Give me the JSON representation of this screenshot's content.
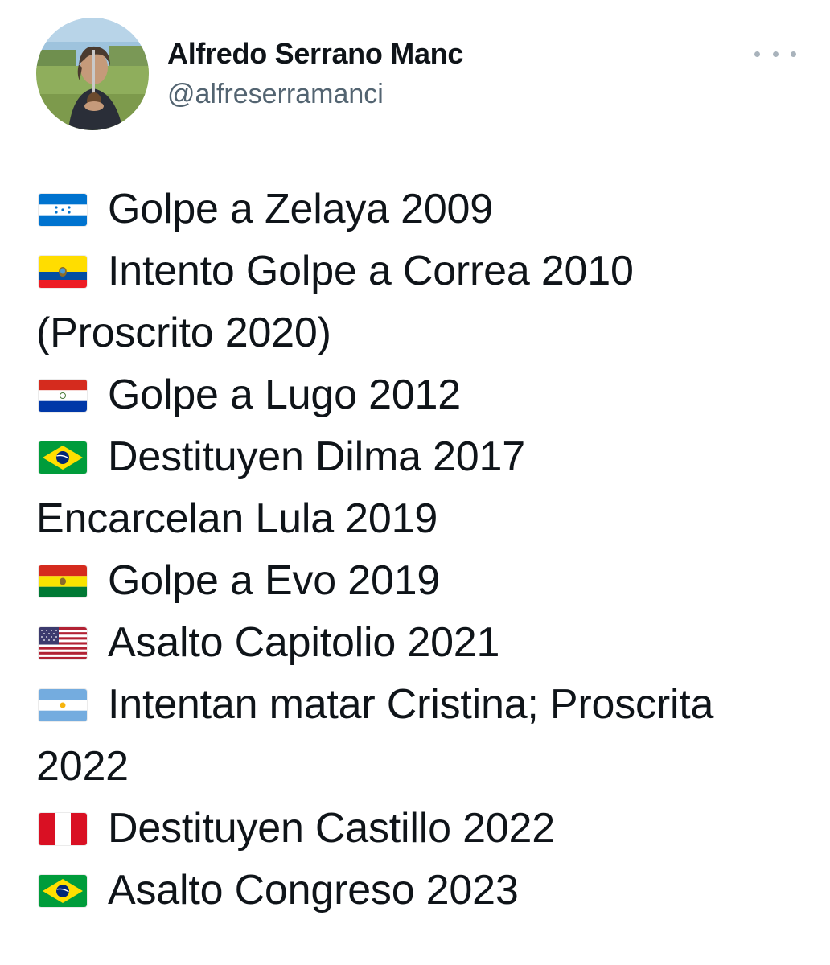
{
  "tweet": {
    "display_name": "Alfredo Serrano Manc",
    "handle": "@alfreserramanci",
    "avatar_icon": "profile-photo",
    "more_icon": "more-options-icon",
    "lines": [
      {
        "flag": "honduras-flag-icon",
        "text": "Golpe a Zelaya 2009"
      },
      {
        "flag": "ecuador-flag-icon",
        "text": "Intento Golpe a Correa 2010"
      },
      {
        "flag": "",
        "text": "(Proscrito 2020)"
      },
      {
        "flag": "paraguay-flag-icon",
        "text": "Golpe a Lugo 2012"
      },
      {
        "flag": "brazil-flag-icon",
        "text": "Destituyen Dilma 2017"
      },
      {
        "flag": "",
        "text": "Encarcelan Lula 2019"
      },
      {
        "flag": "bolivia-flag-icon",
        "text": "Golpe a Evo 2019"
      },
      {
        "flag": "usa-flag-icon",
        "text": "Asalto Capitolio 2021"
      },
      {
        "flag": "argentina-flag-icon",
        "text": "Intentan matar Cristina; Proscrita"
      },
      {
        "flag": "",
        "text": "2022"
      },
      {
        "flag": "peru-flag-icon",
        "text": "Destituyen Castillo 2022"
      },
      {
        "flag": "brazil-flag-icon",
        "text": "Asalto Congreso 2023"
      }
    ]
  }
}
